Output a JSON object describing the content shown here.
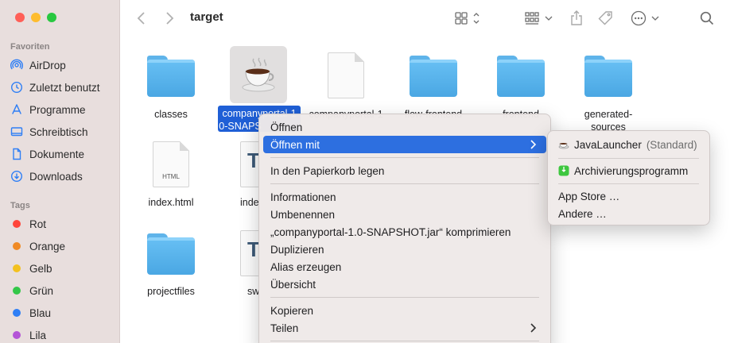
{
  "window": {
    "title": "target"
  },
  "sidebar": {
    "favorites_title": "Favoriten",
    "favorites": [
      {
        "label": "AirDrop",
        "icon": "airdrop-icon"
      },
      {
        "label": "Zuletzt benutzt",
        "icon": "clock-icon"
      },
      {
        "label": "Programme",
        "icon": "apps-icon"
      },
      {
        "label": "Schreibtisch",
        "icon": "desktop-icon"
      },
      {
        "label": "Dokumente",
        "icon": "document-icon"
      },
      {
        "label": "Downloads",
        "icon": "download-icon"
      }
    ],
    "tags_title": "Tags",
    "tags": [
      {
        "label": "Rot",
        "color": "#ff453a"
      },
      {
        "label": "Orange",
        "color": "#f08a25"
      },
      {
        "label": "Gelb",
        "color": "#f3c120"
      },
      {
        "label": "Grün",
        "color": "#34c749"
      },
      {
        "label": "Blau",
        "color": "#2f7ff5"
      },
      {
        "label": "Lila",
        "color": "#b454d7"
      }
    ]
  },
  "files": [
    {
      "label": "classes",
      "kind": "folder"
    },
    {
      "label": "companyportal-1.0-SNAPSHOT.jar",
      "label_line1": "companyportal-1",
      "label_line2": "0-SNAPS",
      "kind": "jar",
      "selected": true
    },
    {
      "label": "companyportal-1",
      "kind": "document"
    },
    {
      "label": "flow-frontend",
      "kind": "folder"
    },
    {
      "label": "frontend",
      "kind": "folder"
    },
    {
      "label_line1": "generated-",
      "label_line2": "sources",
      "kind": "folder"
    },
    {
      "label": "index.html",
      "kind": "html",
      "ext": "HTML"
    },
    {
      "label": "inde",
      "kind": "text"
    },
    {
      "label": "projectfiles",
      "kind": "folder"
    },
    {
      "label": "sw",
      "kind": "text"
    }
  ],
  "context_menu": {
    "open": "Öffnen",
    "open_with": "Öffnen mit",
    "trash": "In den Papierkorb legen",
    "info": "Informationen",
    "rename": "Umbenennen",
    "compress": "„companyportal-1.0-SNAPSHOT.jar“ komprimieren",
    "duplicate": "Duplizieren",
    "alias": "Alias erzeugen",
    "overview": "Übersicht",
    "copy": "Kopieren",
    "share": "Teilen"
  },
  "submenu": {
    "java_launcher": "JavaLauncher",
    "java_launcher_suffix": "(Standard)",
    "archive": "Archivierungsprogramm",
    "app_store": "App Store …",
    "other": "Andere …"
  },
  "colors": {
    "highlight": "#2d6fe0",
    "selection": "#1f5fd6",
    "folder": "#5ab7ef"
  }
}
